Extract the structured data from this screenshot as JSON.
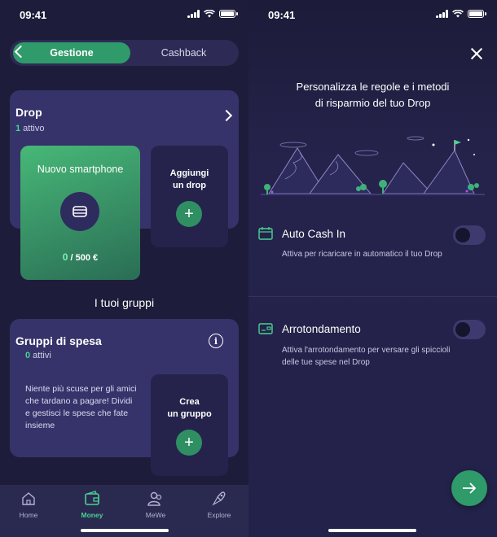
{
  "status_bar": {
    "time": "09:41"
  },
  "left": {
    "segment": {
      "active": "Gestione",
      "inactive": "Cashback"
    },
    "drop_card": {
      "title": "Drop",
      "active_count": "1",
      "active_label": " attivo",
      "featured_drop": {
        "name": "Nuovo smartphone",
        "saved": "0",
        "goal": " / 500 €",
        "icon": "smartphone-icon"
      },
      "add_drop_line1": "Aggiungi",
      "add_drop_line2": "un drop"
    },
    "groups_heading": "I tuoi gruppi",
    "groups_card": {
      "title": "Gruppi di spesa",
      "active_count": "0",
      "active_label": " attivi",
      "description": "Niente più scuse per gli amici che tardano a pagare! Dividi e gestisci le spese che fate insieme",
      "create_line1": "Crea",
      "create_line2": "un gruppo"
    },
    "tabbar": [
      {
        "label": "Home",
        "icon": "home-icon"
      },
      {
        "label": "Money",
        "icon": "wallet-icon",
        "active": true
      },
      {
        "label": "MeWe",
        "icon": "people-icon"
      },
      {
        "label": "Explore",
        "icon": "rocket-icon"
      }
    ]
  },
  "right": {
    "heading_line1": "Personalizza le regole e i metodi",
    "heading_line2": "di risparmio del tuo Drop",
    "settings": [
      {
        "title": "Auto Cash In",
        "desc": "Attiva per ricaricare in automatico il tuo Drop",
        "enabled": false,
        "icon": "calendar-icon"
      },
      {
        "title": "Arrotondamento",
        "desc": "Attiva l'arrotondamento per versare gli spiccioli delle tue spese nel Drop",
        "enabled": false,
        "icon": "wallet-card-icon"
      }
    ]
  },
  "colors": {
    "accent": "#2f9a6a",
    "accent_text": "#4ad292",
    "background": "#1d1c3a",
    "card": "#35336a"
  }
}
